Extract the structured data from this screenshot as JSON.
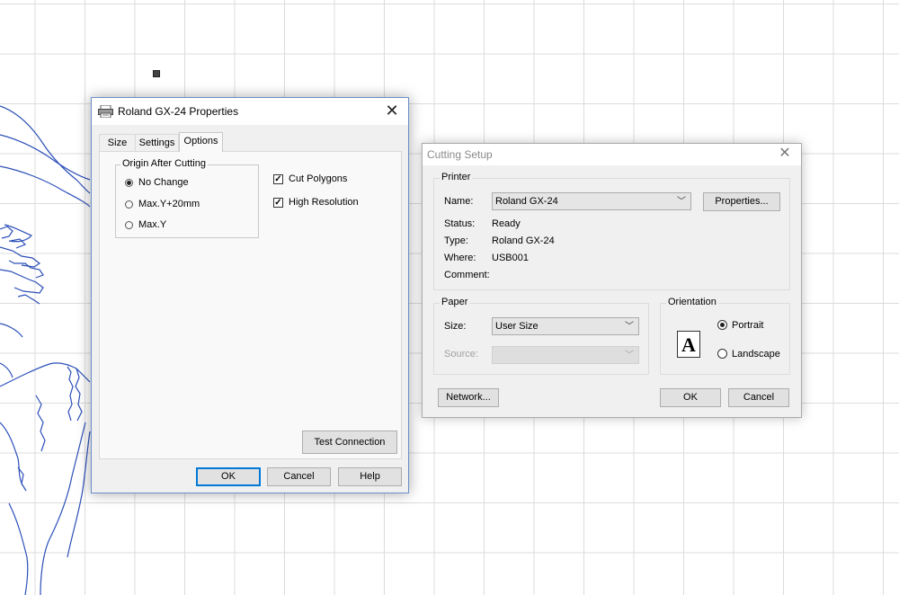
{
  "roland_dialog": {
    "title": "Roland GX-24 Properties",
    "tabs": [
      {
        "label": "Size"
      },
      {
        "label": "Settings"
      },
      {
        "label": "Options"
      }
    ],
    "origin_group": {
      "label": "Origin After Cutting",
      "options": [
        {
          "label": "No Change",
          "checked": true
        },
        {
          "label": "Max.Y+20mm",
          "checked": false
        },
        {
          "label": "Max.Y",
          "checked": false
        }
      ]
    },
    "checkboxes": [
      {
        "label": "Cut Polygons",
        "checked": true
      },
      {
        "label": "High Resolution",
        "checked": true
      }
    ],
    "test_connection_label": "Test Connection",
    "ok_label": "OK",
    "cancel_label": "Cancel",
    "help_label": "Help"
  },
  "cutting_dialog": {
    "title": "Cutting Setup",
    "printer_group": {
      "label": "Printer",
      "name_label": "Name:",
      "name_value": "Roland GX-24",
      "properties_label": "Properties...",
      "status_label": "Status:",
      "status_value": "Ready",
      "type_label": "Type:",
      "type_value": "Roland GX-24",
      "where_label": "Where:",
      "where_value": "USB001",
      "comment_label": "Comment:"
    },
    "paper_group": {
      "label": "Paper",
      "size_label": "Size:",
      "size_value": "User Size",
      "source_label": "Source:"
    },
    "orientation_group": {
      "label": "Orientation",
      "icon_letter": "A",
      "portrait_label": "Portrait",
      "landscape_label": "Landscape",
      "selected": "Portrait"
    },
    "network_label": "Network...",
    "ok_label": "OK",
    "cancel_label": "Cancel"
  },
  "colors": {
    "accent_border": "#0078d7",
    "sketch_line": "#2b4fb8",
    "dialog_bg": "#f0f0f0"
  }
}
